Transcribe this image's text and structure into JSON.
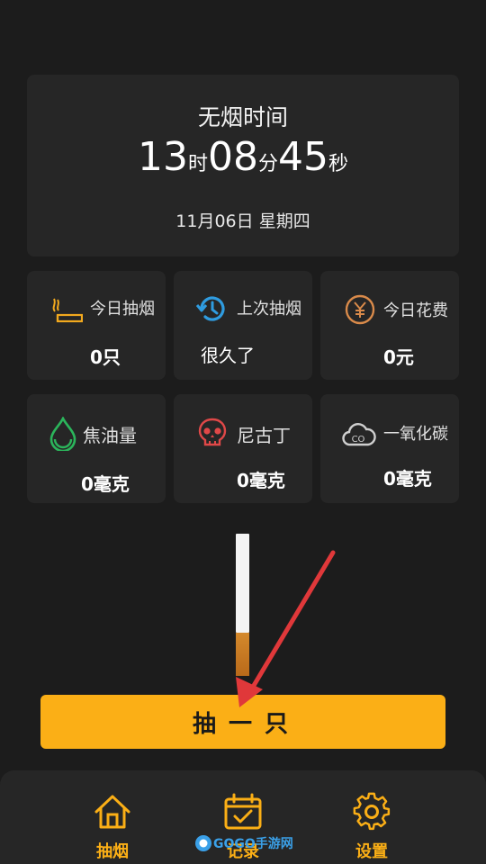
{
  "header": {
    "title": "无烟时间",
    "timer": {
      "hours": "13",
      "hours_unit": "时",
      "minutes": "08",
      "minutes_unit": "分",
      "seconds": "45",
      "seconds_unit": "秒"
    },
    "date": "11月06日 星期四"
  },
  "stats": [
    {
      "label": "今日抽烟",
      "value": "0只",
      "icon": "cigarette-icon",
      "color": "#f2a91e"
    },
    {
      "label": "上次抽烟",
      "value": "很久了",
      "icon": "history-icon",
      "color": "#2f9ce0"
    },
    {
      "label": "今日花费",
      "value": "0元",
      "icon": "yuan-coin-icon",
      "color": "#d98a4a"
    },
    {
      "label": "焦油量",
      "value": "0毫克",
      "icon": "droplet-icon",
      "color": "#2bb55b"
    },
    {
      "label": "尼古丁",
      "value": "0毫克",
      "icon": "skull-icon",
      "color": "#e04848"
    },
    {
      "label": "一氧化碳",
      "value": "0毫克",
      "icon": "co-cloud-icon",
      "color": "#cfcfcf"
    }
  ],
  "action": {
    "smoke_label": "抽一只"
  },
  "nav": [
    {
      "label": "抽烟",
      "icon": "home-icon"
    },
    {
      "label": "记录",
      "icon": "calendar-check-icon"
    },
    {
      "label": "设置",
      "icon": "gear-icon"
    }
  ],
  "watermark": {
    "text": "GOGO手游网"
  },
  "theme": {
    "accent": "#fbaf16",
    "background": "#1c1c1c",
    "card": "#262626"
  }
}
